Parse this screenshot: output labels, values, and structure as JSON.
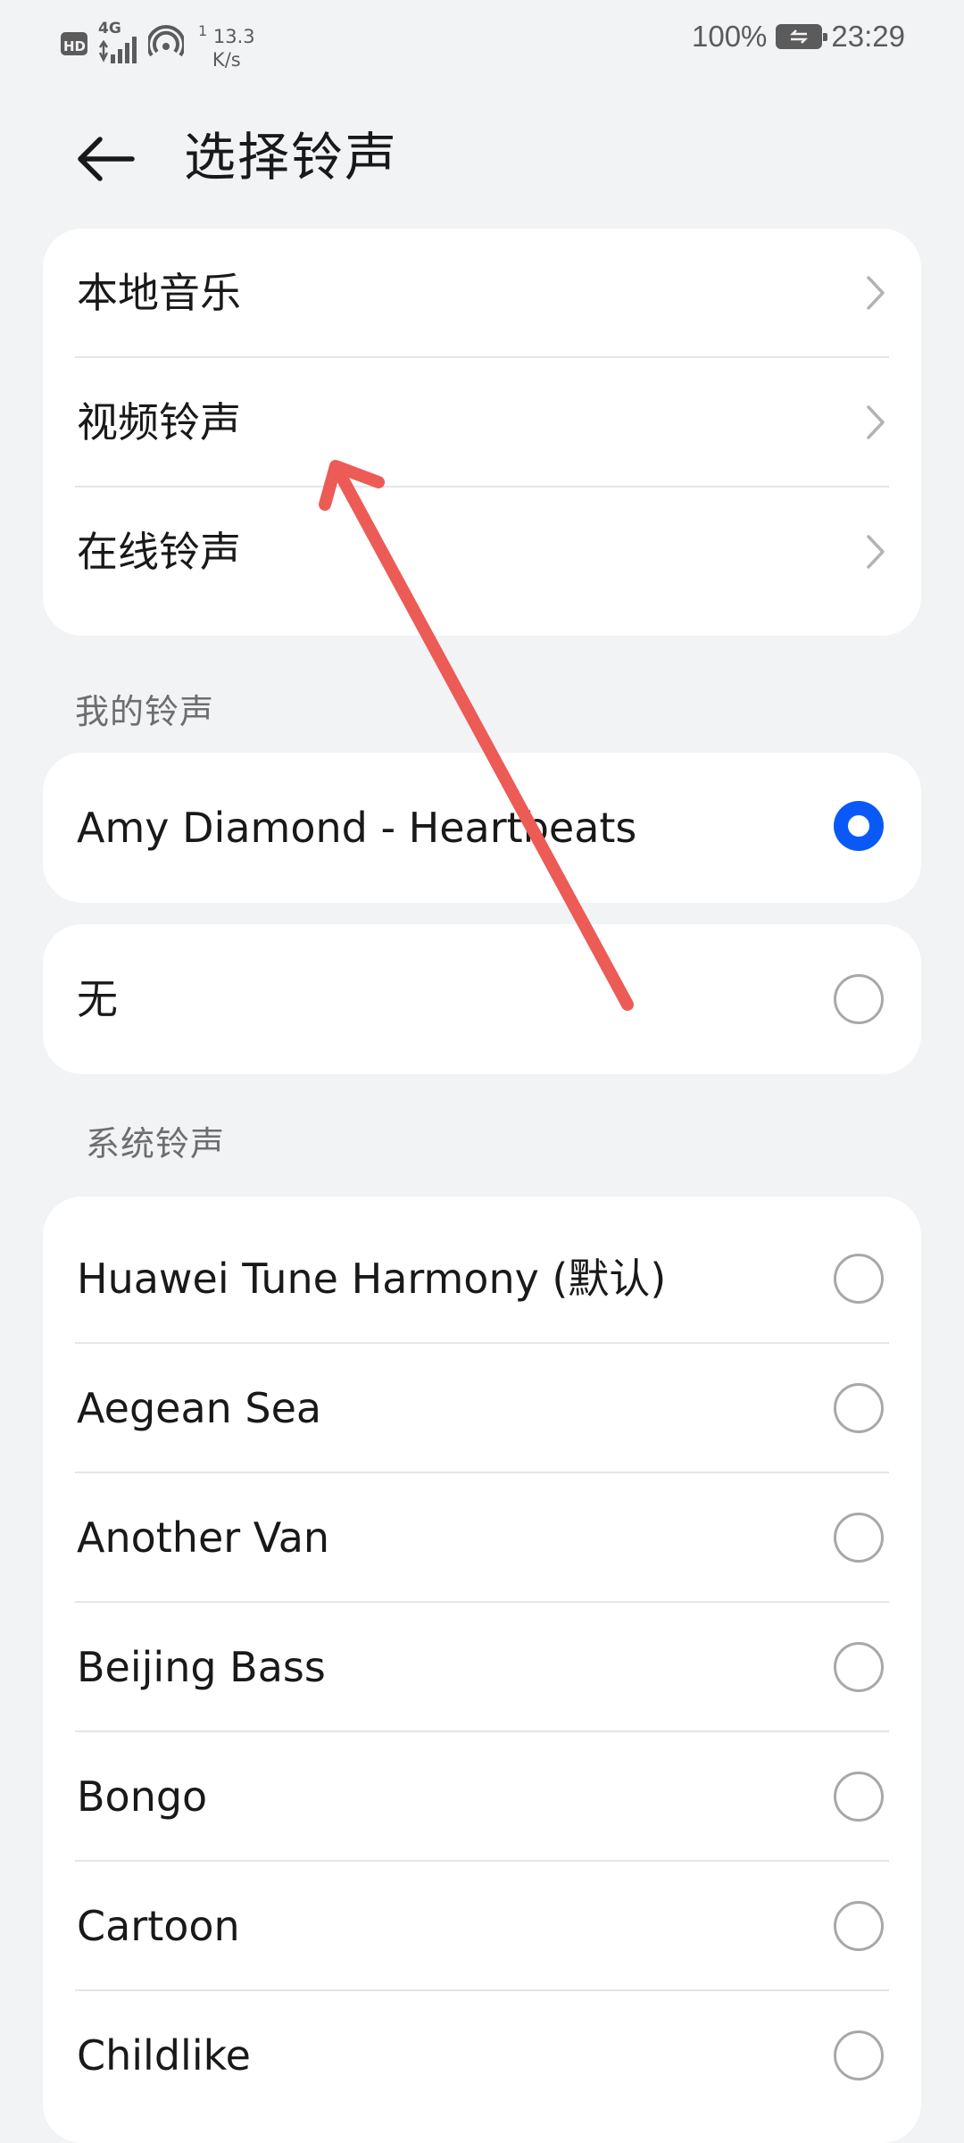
{
  "status_bar": {
    "hd": "HD",
    "network": "4G",
    "speed_sup": "1",
    "speed_value": "13.3",
    "speed_unit": "K/s",
    "battery": "100%",
    "time": "23:29"
  },
  "header": {
    "title": "选择铃声"
  },
  "sources": [
    {
      "label": "本地音乐"
    },
    {
      "label": "视频铃声"
    },
    {
      "label": "在线铃声"
    }
  ],
  "my_ringtones": {
    "section_label": "我的铃声",
    "selected": {
      "label": "Amy Diamond - Heartbeats",
      "checked": true
    },
    "none": {
      "label": "无",
      "checked": false
    }
  },
  "system_ringtones": {
    "section_label": "系统铃声",
    "items": [
      {
        "label": "Huawei Tune Harmony (默认)",
        "checked": false
      },
      {
        "label": "Aegean Sea",
        "checked": false
      },
      {
        "label": "Another Van",
        "checked": false
      },
      {
        "label": "Beijing Bass",
        "checked": false
      },
      {
        "label": "Bongo",
        "checked": false
      },
      {
        "label": "Cartoon",
        "checked": false
      },
      {
        "label": "Childlike",
        "checked": false
      }
    ]
  },
  "colors": {
    "accent": "#0a59f7",
    "annotation_arrow": "#ec5b56",
    "background": "#f1f3f5"
  }
}
